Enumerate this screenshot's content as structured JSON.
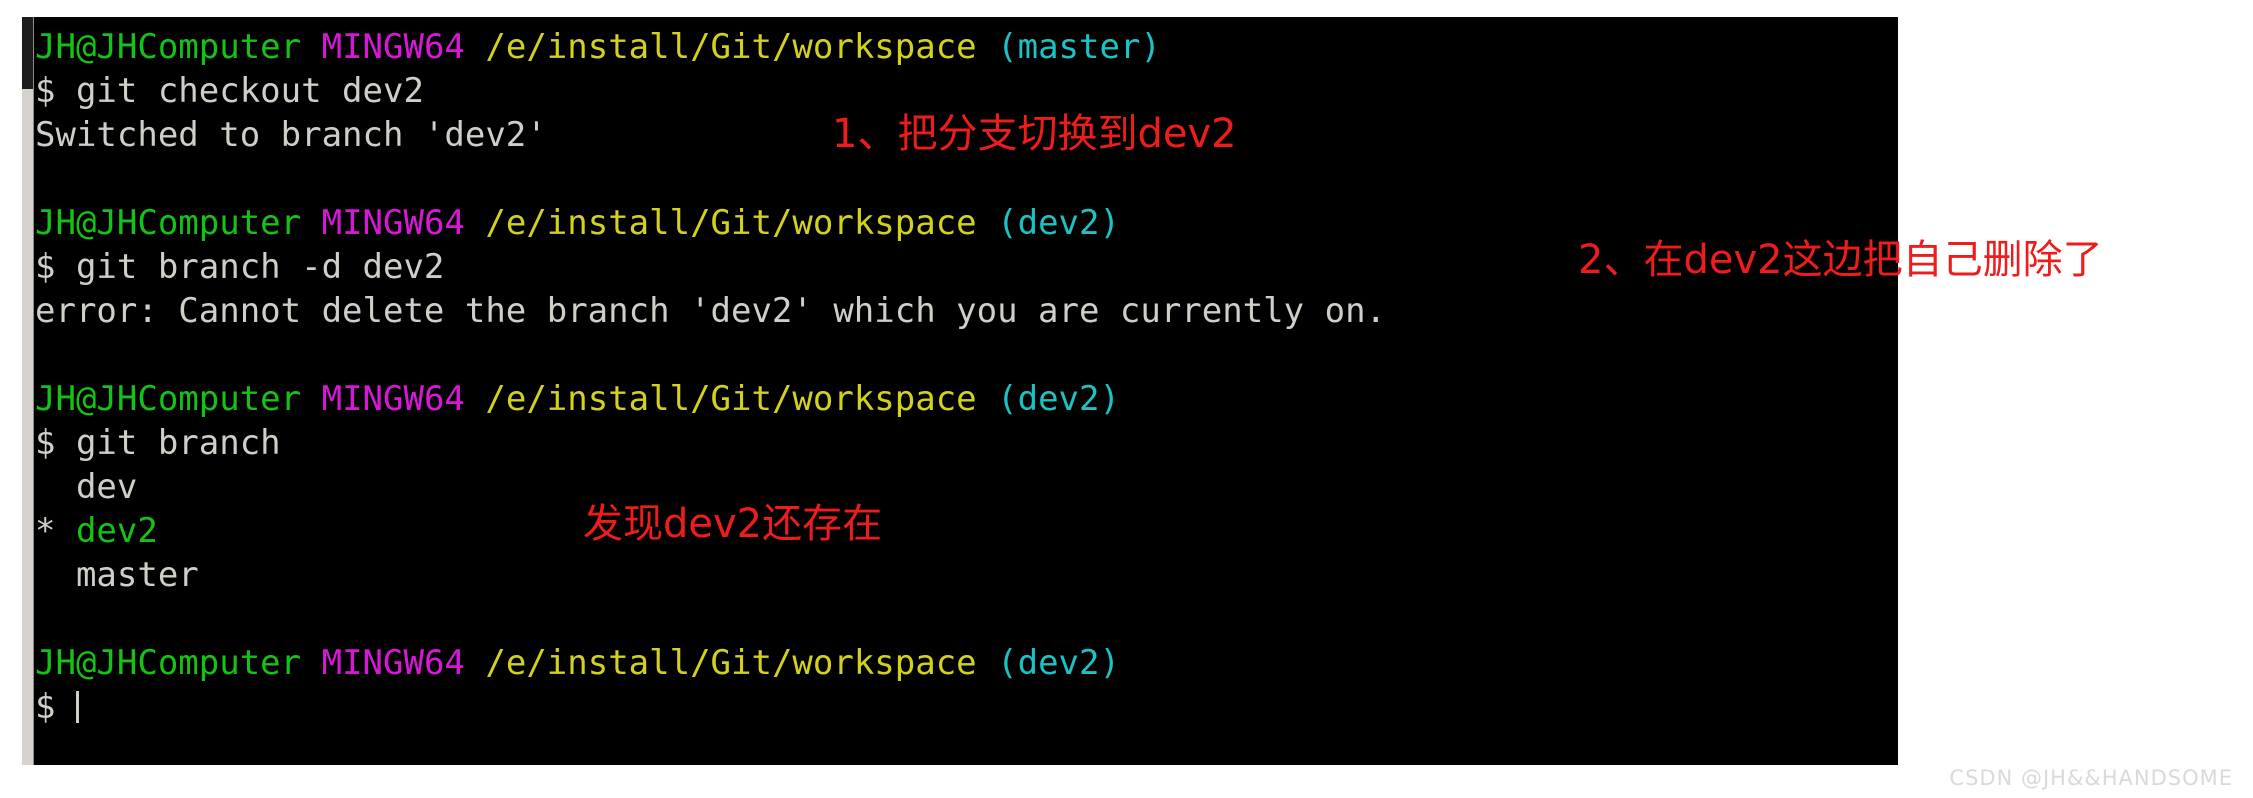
{
  "terminal": {
    "background_color": "#000000",
    "colors": {
      "user": "#15c315",
      "host": "#d817d8",
      "path": "#d2d21d",
      "branch": "#18c4c4",
      "output": "#cfcfc8",
      "annotation": "#ef1c1c"
    },
    "prompt": {
      "user": "JH@JHComputer",
      "host": "MINGW64",
      "path": "/e/install/Git/workspace",
      "dollar": "$"
    },
    "blocks": [
      {
        "prompt_branch": "(master)",
        "command": "$ git checkout dev2",
        "output": [
          "Switched to branch 'dev2'"
        ]
      },
      {
        "prompt_branch": "(dev2)",
        "command": "$ git branch -d dev2",
        "output": [
          "error: Cannot delete the branch 'dev2' which you are currently on."
        ]
      },
      {
        "prompt_branch": "(dev2)",
        "command": "$ git branch",
        "output": [
          "  dev",
          "* dev2",
          "  master"
        ],
        "branch_list": [
          {
            "marker": "  ",
            "name": "dev",
            "current": false
          },
          {
            "marker": "* ",
            "name": "dev2",
            "current": true
          },
          {
            "marker": "  ",
            "name": "master",
            "current": false
          }
        ]
      },
      {
        "prompt_branch": "(dev2)",
        "command": "$ ",
        "output": []
      }
    ]
  },
  "annotations": [
    {
      "id": "annotation-1",
      "text": "1、把分支切换到dev2"
    },
    {
      "id": "annotation-2",
      "text": "2、在dev2这边把自己删除了"
    },
    {
      "id": "annotation-3",
      "text": "发现dev2还存在"
    }
  ],
  "watermark": {
    "text": "CSDN @JH&&HANDSOME"
  }
}
